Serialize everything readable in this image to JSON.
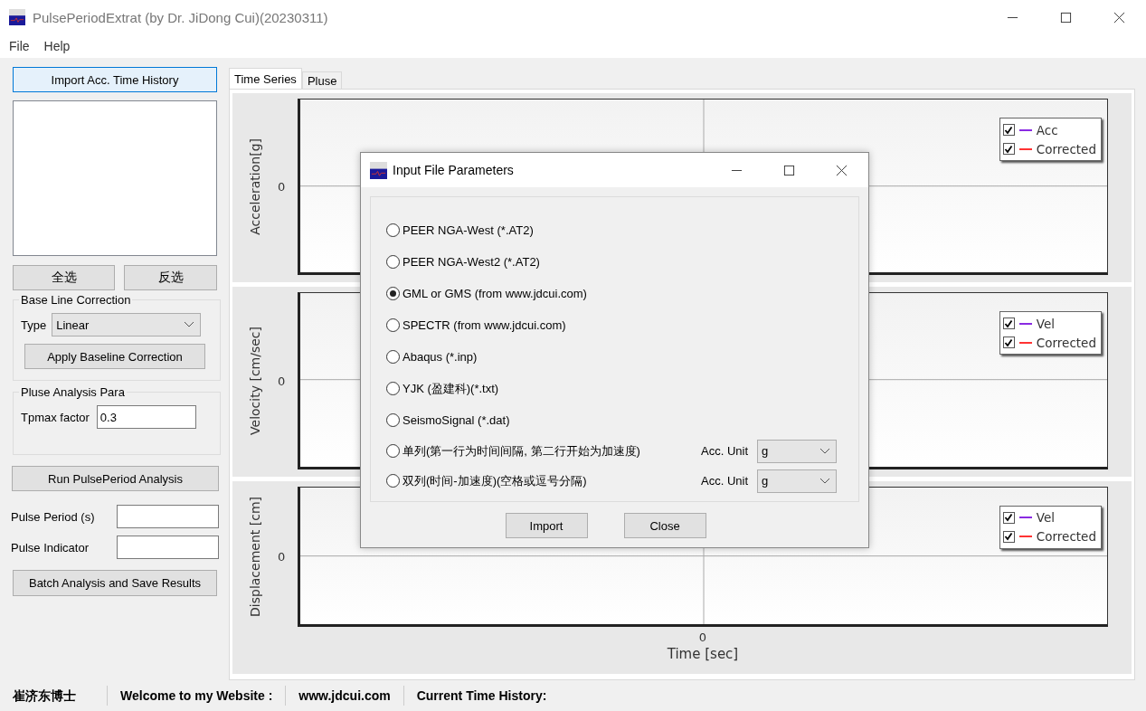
{
  "window": {
    "title": "PulsePeriodExtrat (by Dr. JiDong Cui)(20230311)"
  },
  "menu": [
    "File",
    "Help"
  ],
  "left_panel": {
    "import_button": "Import Acc. Time History",
    "select_all_button": "全选",
    "invert_button": "反选",
    "baseline": {
      "title": "Base Line Correction",
      "type_label": "Type",
      "type_value": "Linear",
      "apply_button": "Apply Baseline Correction"
    },
    "pulse_para": {
      "title": "Pluse Analysis Para",
      "factor_label": "Tpmax factor",
      "factor_value": "0.3"
    },
    "run_button": "Run PulsePeriod Analysis",
    "outputs": [
      {
        "label": "Pulse Period (s)"
      },
      {
        "label": "Pulse Indicator"
      }
    ],
    "batch_button": "Batch Analysis and Save Results"
  },
  "tabs": [
    {
      "label": "Time Series",
      "selected": true
    },
    {
      "label": "Pluse",
      "selected": false
    }
  ],
  "charts": [
    {
      "ylabel": "Acceleration[g]",
      "ytick": "0",
      "legend": [
        {
          "label": "Acc",
          "checked": true,
          "color": "#8a2be2"
        },
        {
          "label": "Corrected",
          "checked": true,
          "color": "#ff3333"
        }
      ]
    },
    {
      "ylabel": "Velocity [cm/sec]",
      "ytick": "0",
      "legend": [
        {
          "label": "Vel",
          "checked": true,
          "color": "#8a2be2"
        },
        {
          "label": "Corrected",
          "checked": true,
          "color": "#ff3333"
        }
      ]
    },
    {
      "ylabel": "Displacement [cm]",
      "ytick": "0",
      "xtick": "0",
      "xlabel": "Time [sec]",
      "legend": [
        {
          "label": "Vel",
          "checked": true,
          "color": "#8a2be2"
        },
        {
          "label": "Corrected",
          "checked": true,
          "color": "#ff3333"
        }
      ]
    }
  ],
  "dialog": {
    "title": "Input File Parameters",
    "options": [
      {
        "kind": "plain",
        "label": "PEER NGA-West (*.AT2)",
        "selected": false
      },
      {
        "kind": "plain",
        "label": "PEER NGA-West2 (*.AT2)",
        "selected": false
      },
      {
        "kind": "plain",
        "label": "GML or GMS (from www.jdcui.com)",
        "selected": true
      },
      {
        "kind": "plain",
        "label": "SPECTR (from www.jdcui.com)",
        "selected": false
      },
      {
        "kind": "plain",
        "label": "Abaqus (*.inp)",
        "selected": false
      },
      {
        "kind": "plain",
        "label": "YJK (盈建科)(*.txt)",
        "selected": false
      },
      {
        "kind": "plain",
        "label": "SeismoSignal (*.dat)",
        "selected": false
      },
      {
        "kind": "unit",
        "label": "单列(第一行为时间间隔, 第二行开始为加速度)",
        "selected": false,
        "unit_label": "Acc. Unit",
        "unit_value": "g"
      },
      {
        "kind": "unit",
        "label": "双列(时间-加速度)(空格或逗号分隔)",
        "selected": false,
        "unit_label": "Acc. Unit",
        "unit_value": "g"
      }
    ],
    "buttons": [
      "Import",
      "Close"
    ]
  },
  "status_bar": [
    "崔济东博士",
    "Welcome to my Website :",
    "www.jdcui.com",
    "Current Time History:"
  ]
}
